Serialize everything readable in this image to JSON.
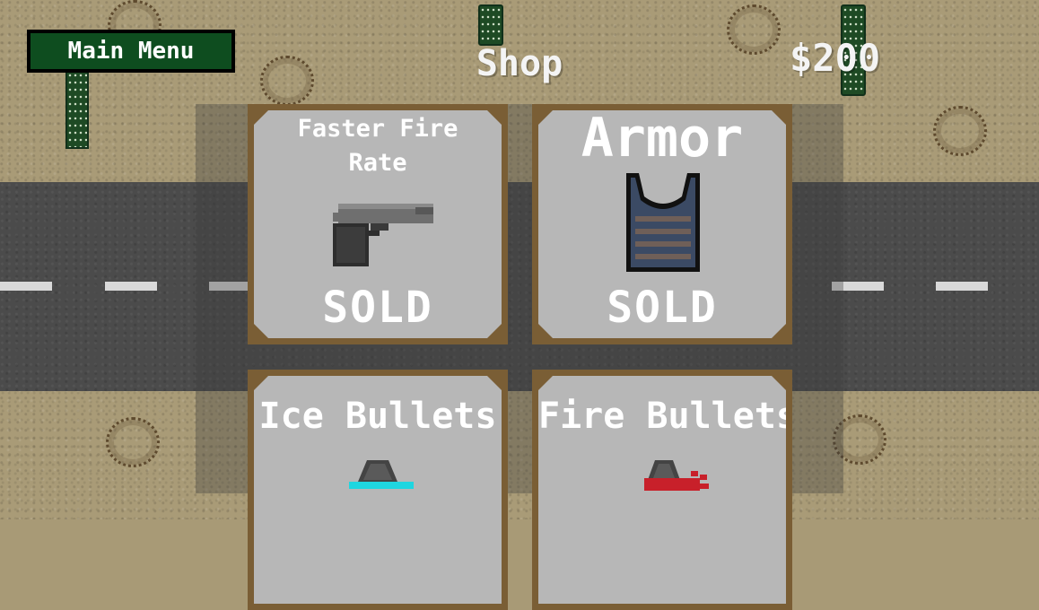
{
  "header": {
    "main_menu_label": "Main Menu",
    "title": "Shop",
    "money": "$200"
  },
  "shop_items": [
    {
      "name": "Faster Fire Rate",
      "status": "SOLD",
      "icon": "pistol-icon"
    },
    {
      "name": "Armor",
      "status": "SOLD",
      "icon": "armor-vest-icon"
    },
    {
      "name": "Ice Bullets",
      "status": "",
      "icon": "ice-bullet-icon"
    },
    {
      "name": "Fire Bullets",
      "status": "",
      "icon": "fire-bullet-icon"
    }
  ],
  "colors": {
    "sand": "#a99b77",
    "road": "#4b4b4b",
    "card_frame": "#7a5e35",
    "card_fill": "#b7b7b7",
    "button_green": "#0e4d1f",
    "ice_accent": "#1fd6e0",
    "fire_accent": "#c8202a"
  }
}
